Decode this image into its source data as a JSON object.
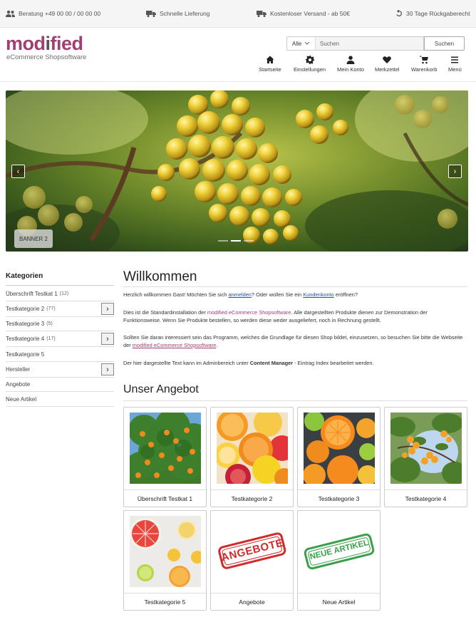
{
  "topbar": {
    "items": [
      {
        "icon": "users-icon",
        "label": "Beratung +49 00 00 / 00 00 00"
      },
      {
        "icon": "truck-icon",
        "label": "Schnelle Lieferung"
      },
      {
        "icon": "shipping-truck-icon",
        "label": "Kostenloser Versand - ab 50€"
      },
      {
        "icon": "undo-icon",
        "label": "30 Tage Rückgaberecht"
      }
    ]
  },
  "logo": {
    "word_part1": "mod",
    "word_part2": "i",
    "word_part3": "fied",
    "tagline": "eCommerce Shopsoftware"
  },
  "search": {
    "category": "Alle",
    "placeholder": "Suchen",
    "button": "Suchen"
  },
  "nav": [
    {
      "icon": "home-icon",
      "label": "Startseite"
    },
    {
      "icon": "gear-icon",
      "label": "Einstellungen"
    },
    {
      "icon": "user-icon",
      "label": "Mein Konto"
    },
    {
      "icon": "heart-icon",
      "label": "Merkzettel"
    },
    {
      "icon": "cart-icon",
      "label": "Warenkorb"
    },
    {
      "icon": "menu-icon",
      "label": "Menü"
    }
  ],
  "slider": {
    "banner_label": "BANNER 2",
    "prev": "‹",
    "next": "›"
  },
  "sidebar": {
    "title": "Kategorien",
    "items": [
      {
        "label": "Überschrift Testkat 1",
        "count": "(12)",
        "expand": false
      },
      {
        "label": "Testkategorie 2",
        "count": "(77)",
        "expand": true
      },
      {
        "label": "Testkategorie 3",
        "count": "(5)",
        "expand": false
      },
      {
        "label": "Testkategorie 4",
        "count": "(17)",
        "expand": true
      },
      {
        "label": "Testkategorie 5",
        "count": "",
        "expand": false
      },
      {
        "label": "Hersteller",
        "count": "",
        "expand": true
      },
      {
        "label": "Angebote",
        "count": "",
        "expand": false
      },
      {
        "label": "Neue Artikel",
        "count": "",
        "expand": false
      }
    ]
  },
  "main": {
    "title": "Willkommen",
    "p1": {
      "a": "Herzlich willkommen Gast! Möchten Sie sich ",
      "link1": "anmelden",
      "b": "? Oder wollen Sie ein ",
      "link2": "Kundenkonto",
      "c": " eröffnen?"
    },
    "p2": {
      "a": "Dies ist die Standardinstallation der ",
      "brand": "modified eCommerce Shopsoftware",
      "b": ". Alle dargestellten Produkte dienen zur Demonstration der Funktionsweise. Wenn Sie Produkte bestellen, so werden diese weder ausgeliefert, noch in Rechnung gestellt."
    },
    "p3": {
      "a": "Sollten Sie daran interessiert sein das Programm, welches die Grundlage für diesen Shop bildet, einzusetzen, so besuchen Sie bitte die Webseite der ",
      "link": "modified eCommerce Shopsoftware",
      "b": "."
    },
    "p4": {
      "a": "Der hier dargestellte Text kann im Adminbereich unter ",
      "strong": "Content Manager",
      "b": " - Eintrag Index bearbeitet werden."
    },
    "offer_title": "Unser Angebot",
    "cards": [
      {
        "label": "Überschrift Testkat 1"
      },
      {
        "label": "Testkategorie 2"
      },
      {
        "label": "Testkategorie 3"
      },
      {
        "label": "Testkategorie 4"
      },
      {
        "label": "Testkategorie 5"
      },
      {
        "label": "Angebote",
        "stamp": "ANGEBOTE"
      },
      {
        "label": "Neue Artikel",
        "stamp": "NEUE ARTIKEL"
      }
    ]
  },
  "colors": {
    "brand": "#a13f74",
    "link": "#1a55b0",
    "stamp_red": "#d12b2b",
    "stamp_green": "#3aa14a"
  }
}
